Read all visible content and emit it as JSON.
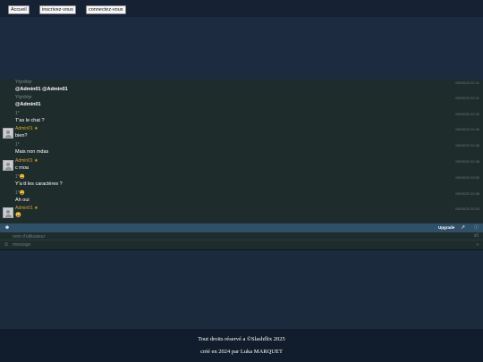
{
  "nav": {
    "home_label": "Accueil",
    "register_label": "inscrivez-vous",
    "login_label": "connectez-vous"
  },
  "chat": {
    "messages": [
      {
        "author": "Ytyrdrtyr",
        "text": "@Admin01 @Admin01",
        "time": "06/03/25 22:41",
        "admin": false,
        "avatar": false,
        "bold": true
      },
      {
        "author": "Ytyrdrtyr",
        "text": "@Admin01",
        "time": "06/03/25 22:41",
        "admin": false,
        "avatar": false,
        "bold": true
      },
      {
        "author": "1*",
        "text": "T'as le chat ?",
        "time": "06/03/25 22:42",
        "admin": false,
        "avatar": false,
        "bold": false
      },
      {
        "author": "Admin01",
        "text": "bien?",
        "time": "06/03/25 22:46",
        "admin": true,
        "avatar": true,
        "bold": false
      },
      {
        "author": "1*",
        "text": "Mais non mdas",
        "time": "06/03/25 22:48",
        "admin": false,
        "avatar": false,
        "bold": false
      },
      {
        "author": "Admin01",
        "text": "c moa",
        "time": "06/03/25 22:48",
        "admin": true,
        "avatar": true,
        "bold": false
      },
      {
        "author": "1*😀",
        "text": "Y'a tt les caractères ?",
        "time": "06/03/25 22:50",
        "admin": false,
        "avatar": false,
        "bold": false
      },
      {
        "author": "1*😀",
        "text": "Ah oui",
        "time": "06/03/25 22:48",
        "admin": false,
        "avatar": false,
        "bold": false
      },
      {
        "author": "Admin01",
        "text": "😀",
        "time": "06/03/25 22:54",
        "admin": true,
        "avatar": true,
        "bold": false
      }
    ],
    "toolbar": {
      "user_icon": "user-icon",
      "upgrade_label": "Upgrade",
      "popout_icon": "external-link-icon",
      "info_icon": "info-icon"
    },
    "username_placeholder": "nom d'utilisateur",
    "username_clear": "x0",
    "message_placeholder": "message",
    "send_icon": "send-arrow-icon"
  },
  "footer": {
    "copyright": "Tout droits réservé a ©Slashflix 2025",
    "credit": "créé en 2024 par Luka MARQUET"
  },
  "colors": {
    "page_bg": "#1c2a3d",
    "topbar_bg": "#162233",
    "chat_bg": "#1f2c2c",
    "chat_toolbar_bg": "#2f5068",
    "admin_name": "#d4a32a",
    "footer_bg": "#111d2c"
  }
}
